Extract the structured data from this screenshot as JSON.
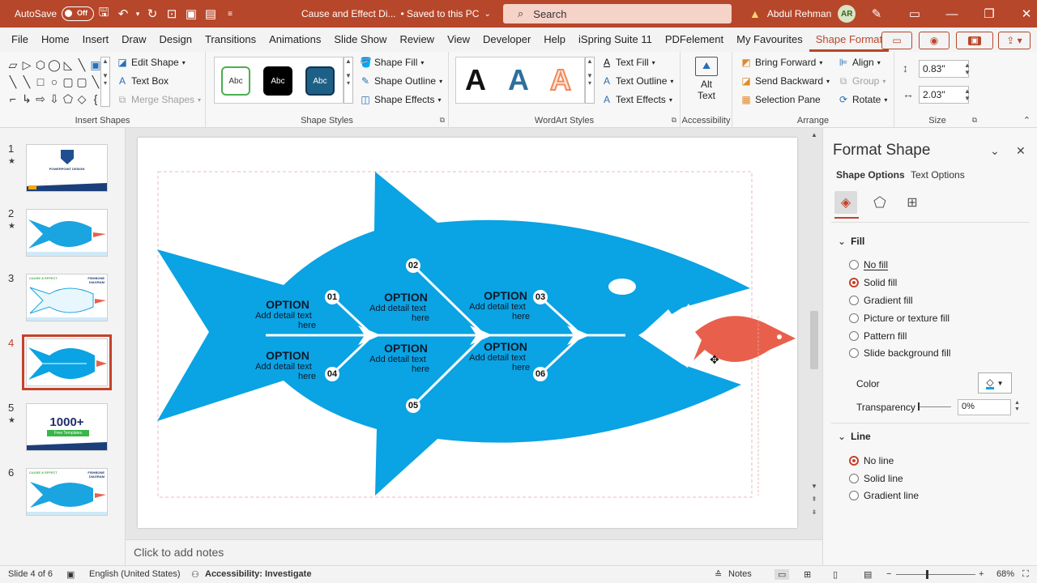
{
  "titlebar": {
    "autosave_label": "AutoSave",
    "autosave_state": "Off",
    "doc_title": "Cause and Effect Di...",
    "save_status": "• Saved to this PC",
    "search_placeholder": "Search",
    "user_name": "Abdul Rehman",
    "user_initials": "AR"
  },
  "tabs": [
    "File",
    "Home",
    "Insert",
    "Draw",
    "Design",
    "Transitions",
    "Animations",
    "Slide Show",
    "Review",
    "View",
    "Developer",
    "Help",
    "iSpring Suite 11",
    "PDFelement",
    "My Favourites",
    "Shape Format"
  ],
  "active_tab": "Shape Format",
  "ribbon": {
    "insert_shapes": {
      "label": "Insert Shapes",
      "edit_shape": "Edit Shape",
      "text_box": "Text Box",
      "merge_shapes": "Merge Shapes"
    },
    "shape_styles": {
      "label": "Shape Styles",
      "swatch_text": "Abc",
      "fill": "Shape Fill",
      "outline": "Shape Outline",
      "effects": "Shape Effects"
    },
    "wordart": {
      "label": "WordArt Styles",
      "letter": "A",
      "text_fill": "Text Fill",
      "text_outline": "Text Outline",
      "text_effects": "Text Effects"
    },
    "accessibility": {
      "label": "Accessibility",
      "alt_text_1": "Alt",
      "alt_text_2": "Text"
    },
    "arrange": {
      "label": "Arrange",
      "bring_forward": "Bring Forward",
      "send_backward": "Send Backward",
      "selection_pane": "Selection Pane",
      "align": "Align",
      "group": "Group",
      "rotate": "Rotate"
    },
    "size": {
      "label": "Size",
      "height": "0.83\"",
      "width": "2.03\""
    }
  },
  "thumbnails": [
    {
      "num": "1",
      "star": "★"
    },
    {
      "num": "2",
      "star": "★"
    },
    {
      "num": "3",
      "star": ""
    },
    {
      "num": "4",
      "star": ""
    },
    {
      "num": "5",
      "star": "★"
    },
    {
      "num": "6",
      "star": ""
    }
  ],
  "thumb_texts": {
    "t1_title": "POWERPOINT DESIGN",
    "t3_title": "CAUSE & EFFECT",
    "t3_sub": "FISHBONE DIAGRAM",
    "t5_title": "1000+",
    "t5_sub": "Free Templates"
  },
  "slide": {
    "options": [
      {
        "num": "01",
        "title": "OPTION",
        "detail1": "Add detail text",
        "detail2": "here"
      },
      {
        "num": "02",
        "title": "OPTION",
        "detail1": "Add detail text",
        "detail2": "here"
      },
      {
        "num": "03",
        "title": "OPTION",
        "detail1": "Add detail text",
        "detail2": "here"
      },
      {
        "num": "04",
        "title": "OPTION",
        "detail1": "Add detail text",
        "detail2": "here"
      },
      {
        "num": "05",
        "title": "OPTION",
        "detail1": "Add detail text",
        "detail2": "here"
      },
      {
        "num": "06",
        "title": "OPTION",
        "detail1": "Add detail text",
        "detail2": "here"
      }
    ],
    "colors": {
      "fish": "#0aa3e3",
      "small_fish": "#e8604c"
    }
  },
  "notes_placeholder": "Click to add notes",
  "pane": {
    "title": "Format Shape",
    "tab_shape": "Shape Options",
    "tab_text": "Text Options",
    "fill_header": "Fill",
    "fill_options": [
      "No fill",
      "Solid fill",
      "Gradient fill",
      "Picture or texture fill",
      "Pattern fill",
      "Slide background fill"
    ],
    "fill_selected": "Solid fill",
    "color_label": "Color",
    "transparency_label": "Transparency",
    "transparency_value": "0%",
    "line_header": "Line",
    "line_options": [
      "No line",
      "Solid line",
      "Gradient line"
    ],
    "line_selected": "No line"
  },
  "status": {
    "slide_info": "Slide 4 of 6",
    "language": "English (United States)",
    "accessibility": "Accessibility: Investigate",
    "notes": "Notes",
    "zoom": "68%"
  }
}
